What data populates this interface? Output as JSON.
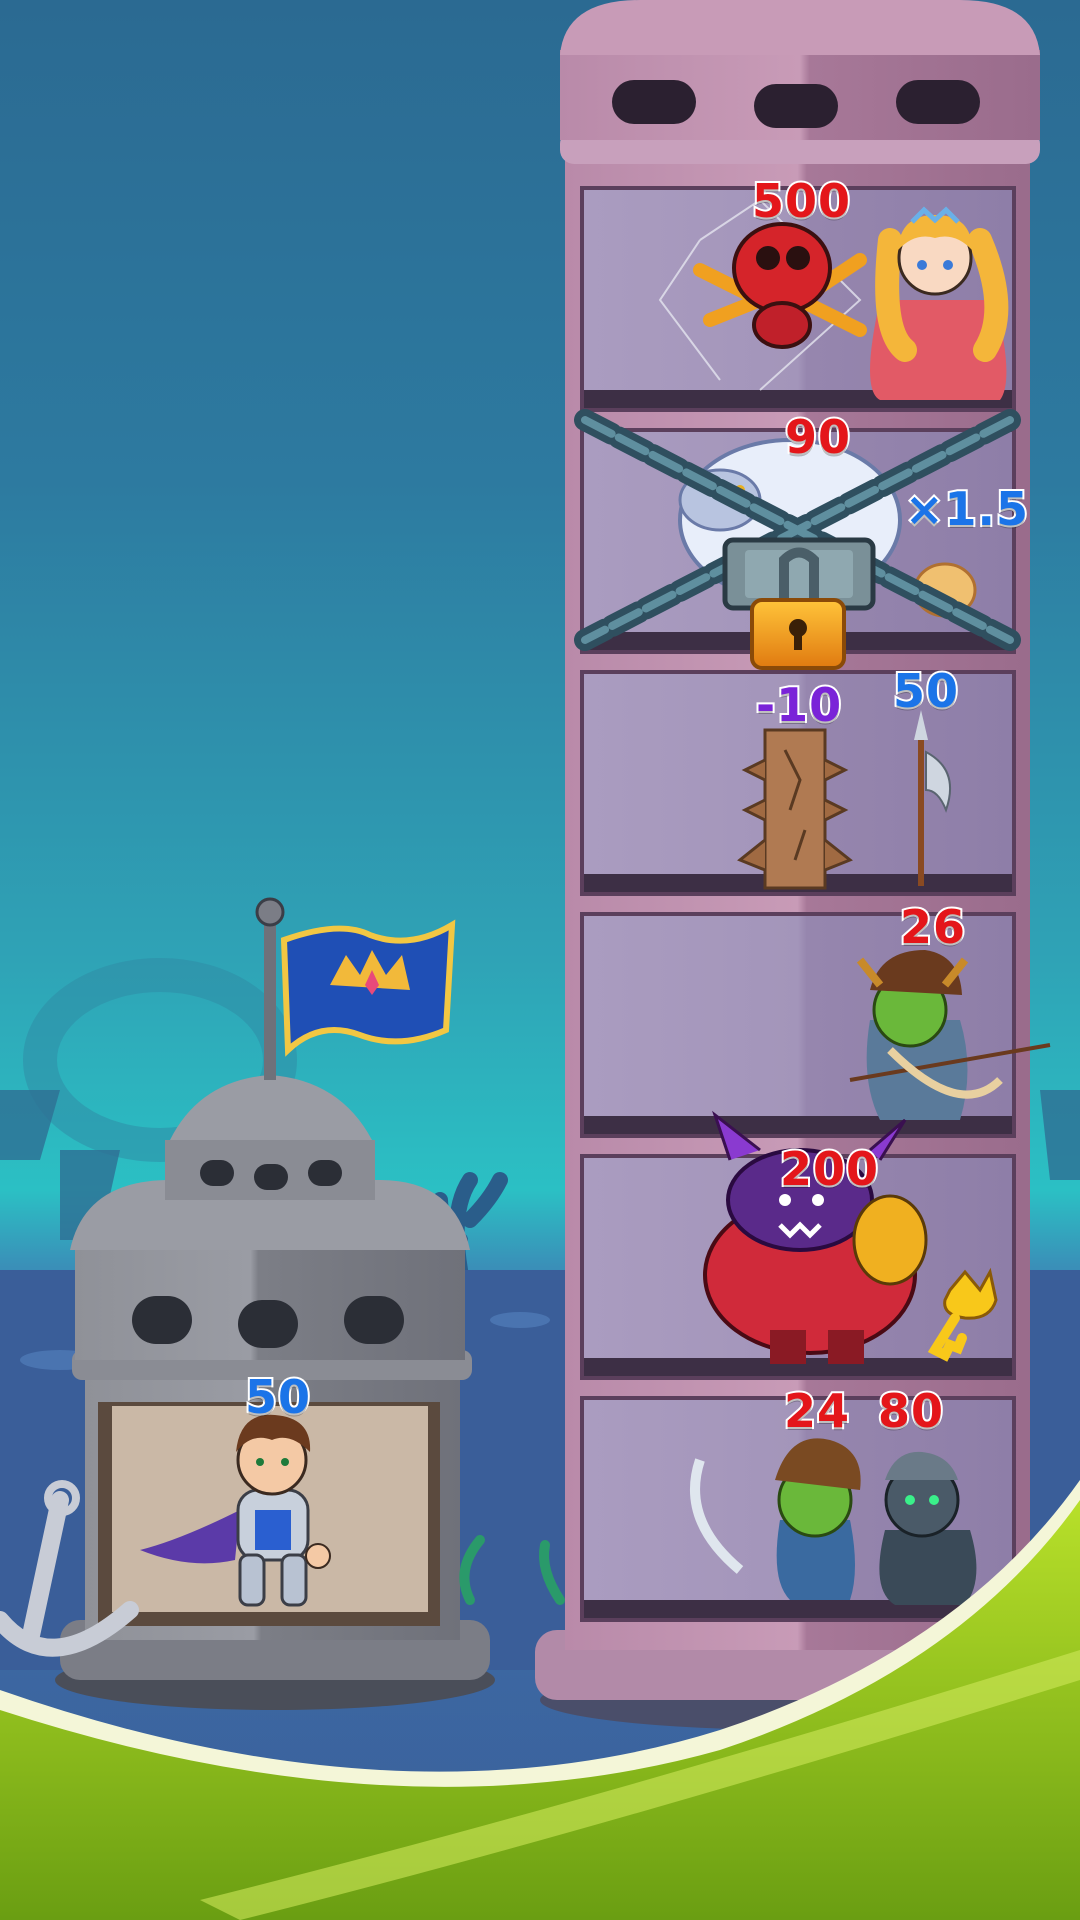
{
  "hero": {
    "name": "hero-knight",
    "power": "50"
  },
  "enemy_tower": {
    "floors": [
      {
        "items": [
          {
            "kind": "spider",
            "power": "500"
          },
          {
            "kind": "princess"
          }
        ]
      },
      {
        "locked": true,
        "items": [
          {
            "kind": "yeti",
            "power": "90"
          },
          {
            "kind": "multiplier",
            "power": "1.5"
          },
          {
            "kind": "bread"
          }
        ]
      },
      {
        "items": [
          {
            "kind": "spike-trap",
            "power": "-10"
          },
          {
            "kind": "halberd",
            "power": "50"
          }
        ]
      },
      {
        "items": [
          {
            "kind": "goblin-archer",
            "power": "26"
          }
        ]
      },
      {
        "items": [
          {
            "kind": "demon",
            "power": "200"
          },
          {
            "kind": "key"
          }
        ]
      },
      {
        "items": [
          {
            "kind": "goblin-swordsman",
            "power": "24"
          },
          {
            "kind": "undead-warrior",
            "power": "80"
          }
        ]
      }
    ]
  },
  "colors": {
    "enemy": "#e4161a",
    "ally": "#1b74e8",
    "trap": "#7a23d8",
    "tower_pink": "#b889a8",
    "room_purple": "#a293b8",
    "hero_tower_grey": "#8a8c94",
    "grass": "#8ec21c"
  },
  "icons": [
    "crown-flag-icon",
    "padlock-icon",
    "chain-icon",
    "key-icon",
    "anchor-icon"
  ]
}
